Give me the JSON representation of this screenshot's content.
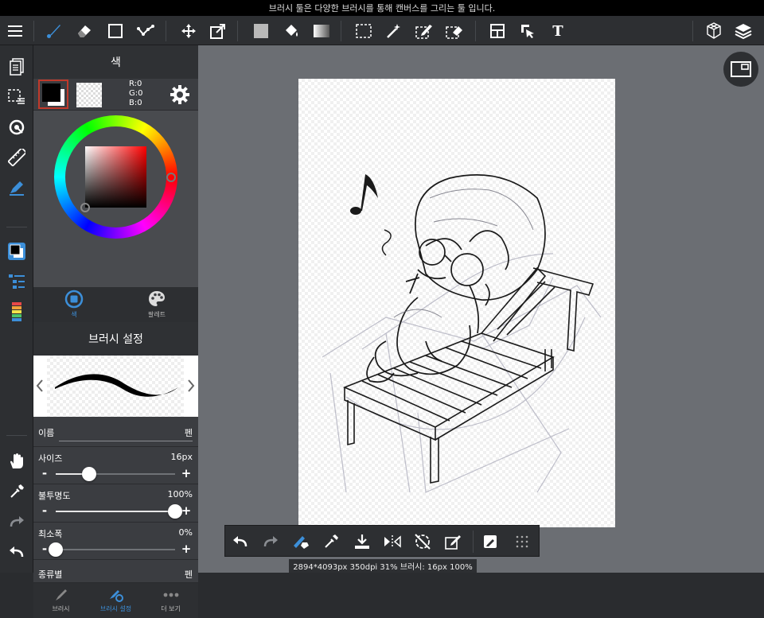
{
  "topbar": {
    "hint": "브러시 툴은 다양한 브러시를 통해 캔버스를 그리는 툴 입니다."
  },
  "color_panel": {
    "title": "색",
    "rgb": {
      "r": "R:0",
      "g": "G:0",
      "b": "B:0"
    },
    "tabs": [
      {
        "label": "색"
      },
      {
        "label": "팔레트"
      }
    ],
    "accent": "#3c8fd9"
  },
  "brush_panel": {
    "title": "브러시 설정",
    "name": {
      "label": "이름",
      "value": "펜"
    },
    "size": {
      "label": "사이즈",
      "value": "16px",
      "level": 0.28
    },
    "opacity": {
      "label": "불투명도",
      "value": "100%",
      "level": 1.0
    },
    "min_width": {
      "label": "최소폭",
      "value": "0%",
      "level": 0.0
    },
    "kind": {
      "label": "종류별",
      "value": "펜"
    },
    "minus": "-",
    "plus": "+"
  },
  "bottom_tabs": [
    {
      "label": "브러시"
    },
    {
      "label": "브러시 설정"
    },
    {
      "label": "더 보기"
    }
  ],
  "status": {
    "text": "2894*4093px 350dpi 31% 브러시: 16px 100%"
  },
  "toolbar": {
    "text_tool": "T"
  }
}
